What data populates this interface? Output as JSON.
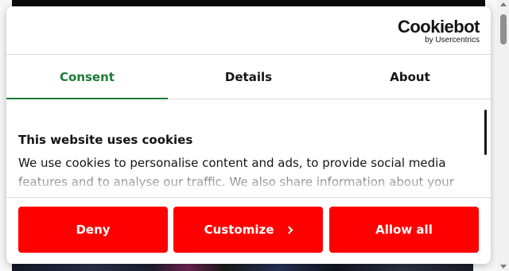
{
  "logo": {
    "main": "Cookiebot",
    "sub": "by Usercentrics"
  },
  "tabs": [
    {
      "label": "Consent",
      "active": true
    },
    {
      "label": "Details",
      "active": false
    },
    {
      "label": "About",
      "active": false
    }
  ],
  "content": {
    "title": "This website uses cookies",
    "text": "We use cookies to personalise content and ads, to provide social media features and to analyse our traffic. We also share information about your"
  },
  "buttons": {
    "deny": "Deny",
    "customize": "Customize",
    "allow_all": "Allow all"
  },
  "icons": {
    "customize": "chevron-right-icon"
  },
  "colors": {
    "accent": "#1d7a36",
    "button": "#ff0000",
    "button_text": "#ffffff"
  }
}
